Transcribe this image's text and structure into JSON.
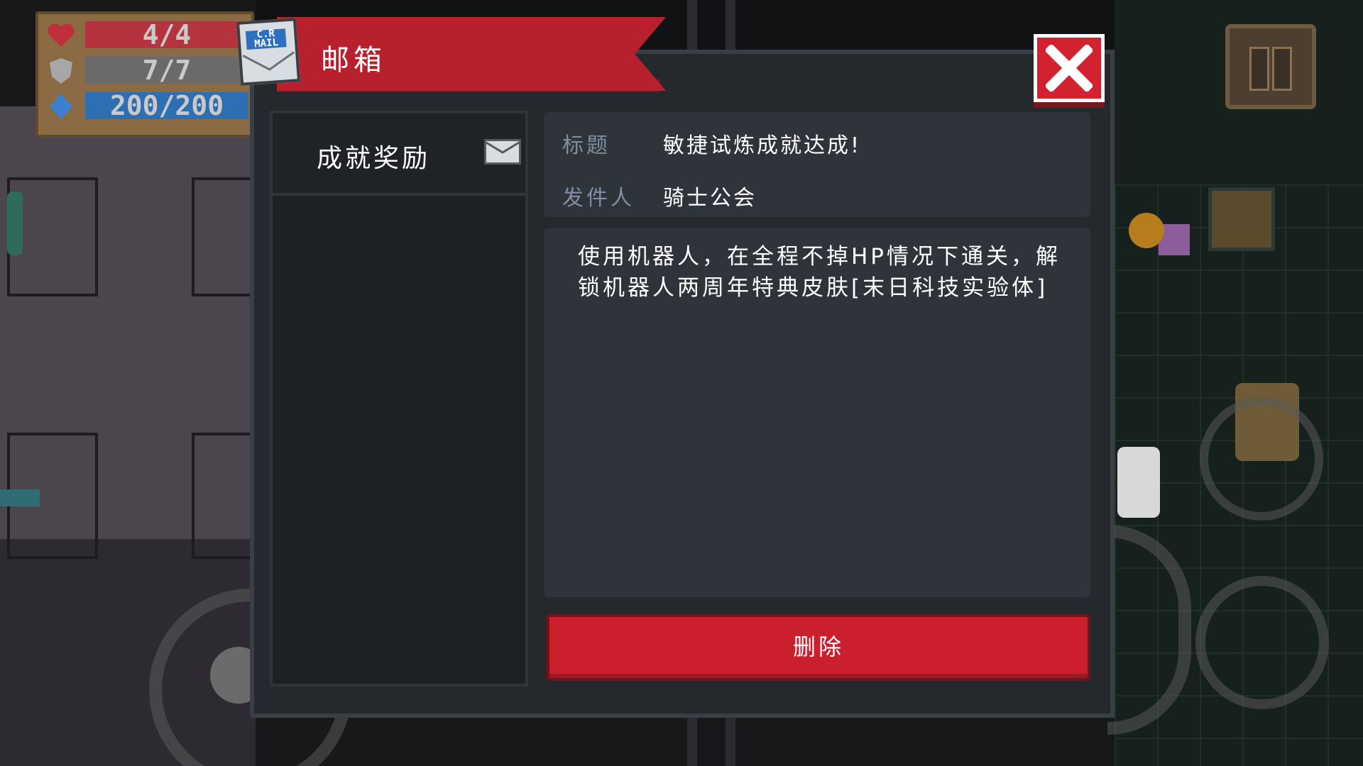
{
  "hud": {
    "health": "4/4",
    "armor": "7/7",
    "energy": "200/200"
  },
  "mailbox": {
    "title": "邮箱",
    "mail_icon_text": "C.R MAIL",
    "list_items": [
      {
        "label": "成就奖励"
      }
    ],
    "subject_label": "标题",
    "subject_value": "敏捷试炼成就达成!",
    "sender_label": "发件人",
    "sender_value": "骑士公会",
    "body": "使用机器人，在全程不掉HP情况下通关，解锁机器人两周年特典皮肤[末日科技实验体]",
    "delete_label": "删除"
  },
  "colors": {
    "banner_red": "#b9202d",
    "button_red": "#cc1f2e",
    "panel_bg": "#2f343a",
    "dialog_bg": "#25292e",
    "label_blue_gray": "#7f8ea0"
  },
  "icons": [
    "heart-icon",
    "shield-icon",
    "energy-icon",
    "mail-icon",
    "close-icon",
    "envelope-icon",
    "pause-icon"
  ]
}
